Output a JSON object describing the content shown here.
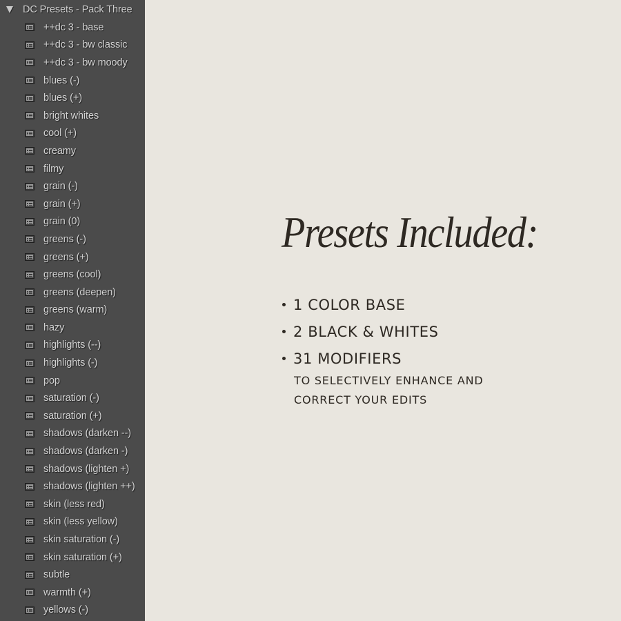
{
  "sidebar": {
    "folder": {
      "label": "DC Presets - Pack Three",
      "expanded": true,
      "icon": "triangle-down-icon"
    },
    "item_icon": "preset-icon",
    "items": [
      {
        "label": "++dc 3 - base"
      },
      {
        "label": "++dc 3 - bw classic"
      },
      {
        "label": "++dc 3 - bw moody"
      },
      {
        "label": "blues  (-)"
      },
      {
        "label": "blues (+)"
      },
      {
        "label": "bright whites"
      },
      {
        "label": "cool (+)"
      },
      {
        "label": "creamy"
      },
      {
        "label": "filmy"
      },
      {
        "label": "grain (-)"
      },
      {
        "label": "grain (+)"
      },
      {
        "label": "grain (0)"
      },
      {
        "label": "greens (-)"
      },
      {
        "label": "greens (+)"
      },
      {
        "label": "greens (cool)"
      },
      {
        "label": "greens (deepen)"
      },
      {
        "label": "greens (warm)"
      },
      {
        "label": "hazy"
      },
      {
        "label": "highlights (--)"
      },
      {
        "label": "highlights (-)"
      },
      {
        "label": "pop"
      },
      {
        "label": "saturation (-)"
      },
      {
        "label": "saturation (+)"
      },
      {
        "label": "shadows (darken --)"
      },
      {
        "label": "shadows (darken -)"
      },
      {
        "label": "shadows (lighten +)"
      },
      {
        "label": "shadows (lighten ++)"
      },
      {
        "label": "skin (less red)"
      },
      {
        "label": "skin (less yellow)"
      },
      {
        "label": "skin saturation (-)"
      },
      {
        "label": "skin saturation (+)"
      },
      {
        "label": "subtle"
      },
      {
        "label": "warmth (+)"
      },
      {
        "label": "yellows (-)"
      }
    ]
  },
  "main": {
    "title": "Presets Included:",
    "bullets": [
      {
        "text": "1 COLOR BASE"
      },
      {
        "text": "2 BLACK & WHITES"
      },
      {
        "text": "31 MODIFIERS"
      }
    ],
    "subnote": "TO SELECTIVELY ENHANCE AND CORRECT YOUR EDITS"
  },
  "colors": {
    "sidebar_bg": "#4b4b4b",
    "sidebar_text": "#d2d2d2",
    "main_bg": "#e9e6df",
    "main_text": "#2e2923"
  }
}
